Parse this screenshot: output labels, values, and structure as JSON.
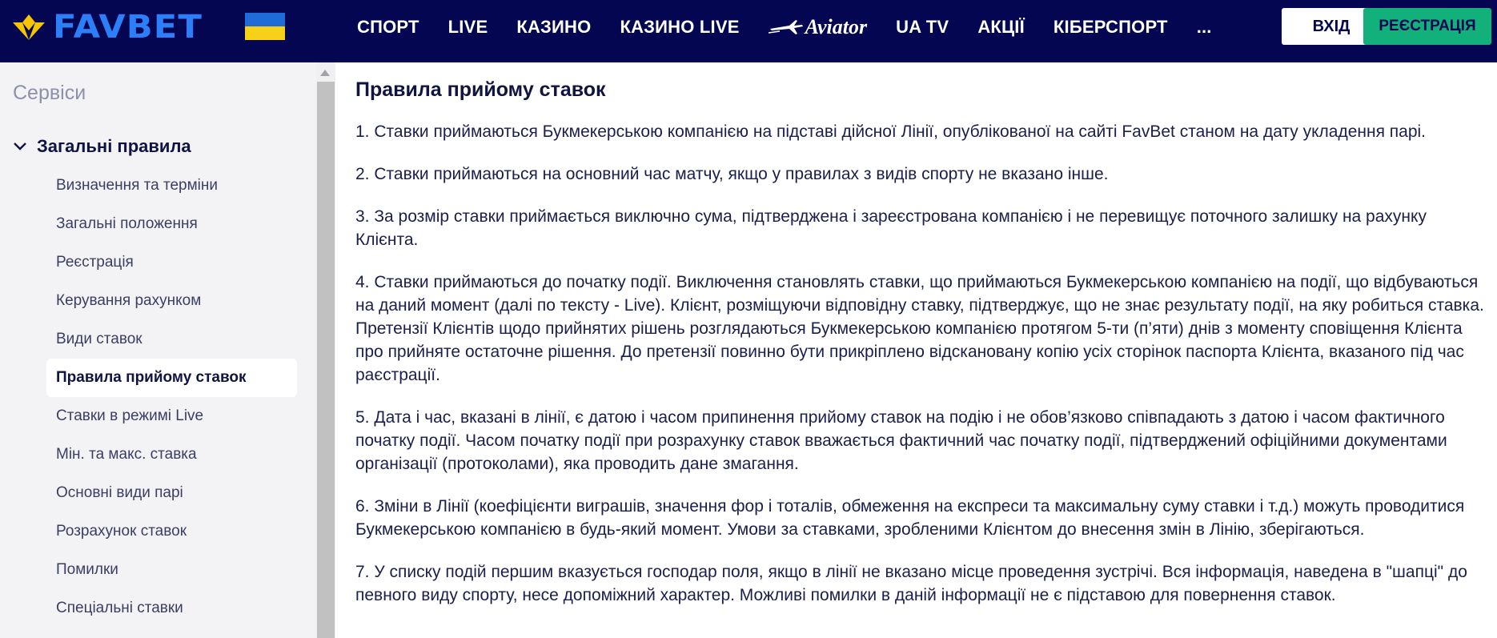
{
  "header": {
    "logo_text": "FAVBET",
    "nav": [
      {
        "label": "СПОРТ"
      },
      {
        "label": "LIVE"
      },
      {
        "label": "КАЗИНО"
      },
      {
        "label": "КАЗИНО LIVE"
      },
      {
        "label": "Aviator",
        "icon": "airplane-icon"
      },
      {
        "label": "UA TV"
      },
      {
        "label": "АКЦІЇ"
      },
      {
        "label": "КІБЕРСПОРТ"
      },
      {
        "label": "..."
      }
    ],
    "login_label": "ВХІД",
    "register_label": "РЕЄСТРАЦІЯ",
    "colors": {
      "background": "#050652",
      "logo": "#2d7ff9",
      "register": "#12b07b"
    }
  },
  "sidebar": {
    "title": "Сервіси",
    "section": "Загальні правила",
    "section_icon": "chevron-down-icon",
    "items": [
      {
        "label": "Визначення та терміни"
      },
      {
        "label": "Загальні положення"
      },
      {
        "label": "Реєстрація"
      },
      {
        "label": "Керування рахунком"
      },
      {
        "label": "Види ставок"
      },
      {
        "label": "Правила прийому ставок",
        "active": true
      },
      {
        "label": "Ставки в режимі Live"
      },
      {
        "label": "Мін. та макс. ставка"
      },
      {
        "label": "Основні види парі"
      },
      {
        "label": "Розрахунок ставок"
      },
      {
        "label": "Помилки"
      },
      {
        "label": "Спеціальні ставки"
      }
    ]
  },
  "content": {
    "title": "Правила прийому ставок",
    "rules": [
      "1. Ставки приймаються Букмекерською компанією на підставі дійсної Лінії, опублікованої на сайті FavBet станом на дату укладення парі.",
      "2. Ставки приймаються на основний час матчу, якщо у правилах з видів спорту не вказано інше.",
      "3. За розмір ставки приймається виключно сума, підтверджена і зареєстрована компанією і не перевищує поточного залишку на рахунку Клієнта.",
      "4. Ставки приймаються до початку події. Виключення становлять ставки, що приймаються Букмекерською компанією на події, що відбуваються на даний момент (далі по тексту - Live). Клієнт, розміщуючи відповідну ставку, підтверджує, що не знає результату події, на яку робиться ставка. Претензії Клієнтів щодо прийнятих рішень розглядаються Букмекерською компанією протягом 5-ти (п’яти) днів з моменту сповіщення Клієнта про прийняте остаточне рішення. До претензії повинно бути прикріплено відскановану копію усіх сторінок паспорта Клієнта, вказаного під час раєстрації.",
      "5. Дата і час, вказані в лінії, є датою і часом припинення прийому ставок на подію і не обов’язково співпадають з датою і часом фактичного початку події. Часом початку події при розрахунку ставок вважається фактичний час початку події, підтверджений офіційними документами організації (протоколами), яка проводить дане змагання.",
      "6. Зміни в Лінії (коефіцієнти виграшів, значення фор і тоталів, обмеження на експреси та максимальну суму ставки і т.д.) можуть проводитися Букмекерською компанією в будь-який момент. Умови за ставками, зробленими Клієнтом до внесення змін в Лінію, зберігаються.",
      "7. У списку подій першим вказується господар поля, якщо в лінії не вказано місце проведення зустрічі. Вся інформація, наведена в \"шапці\" до певного виду спорту, несе допоміжний характер. Можливі помилки в даній інформації не є підставою для повернення ставок."
    ]
  }
}
